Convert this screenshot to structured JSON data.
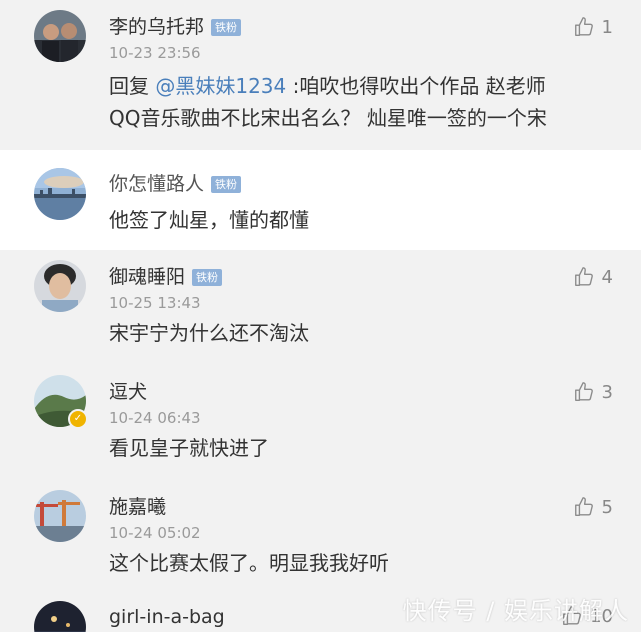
{
  "comments": [
    {
      "name": "李的乌托邦",
      "badge": "铁粉",
      "time": "10-23 23:56",
      "reply_prefix": "回复",
      "mention": "@黑妹妹1234",
      "line1_rest": ":咱吹也得吹出个作品 赵老师",
      "line2": "QQ音乐歌曲不比宋出名么？ 灿星唯一签的一个宋",
      "likes": "1"
    },
    {
      "name": "你怎懂路人",
      "badge": "铁粉",
      "text": "他签了灿星，懂的都懂"
    },
    {
      "name": "御魂睡阳",
      "badge": "铁粉",
      "time": "10-25 13:43",
      "text": "宋宇宁为什么还不淘汰",
      "likes": "4"
    },
    {
      "name": "逗犬",
      "time": "10-24 06:43",
      "text": "看见皇子就快进了",
      "likes": "3"
    },
    {
      "name": "施嘉曦",
      "time": "10-24 05:02",
      "text": "这个比赛太假了。明显我我好听",
      "likes": "5"
    },
    {
      "name": "girl-in-a-bag",
      "likes": "10"
    }
  ],
  "watermark": "快传号 / 娱乐讲解人",
  "icons": {
    "like": "thumbs-up-icon"
  },
  "colors": {
    "mention": "#4a7fbb",
    "badge": "#8fb1d9",
    "background": "#f2f2f2"
  }
}
